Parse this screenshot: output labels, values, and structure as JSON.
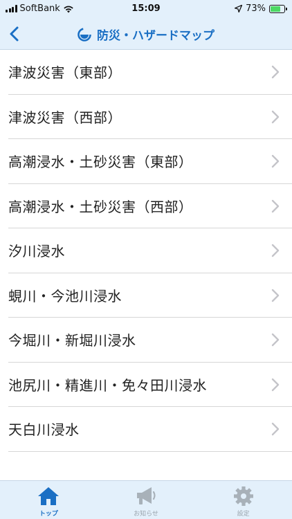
{
  "status": {
    "carrier": "SoftBank",
    "time": "15:09",
    "battery": "73%",
    "battery_level": 0.73
  },
  "nav": {
    "title": "防災・ハザードマップ"
  },
  "list": [
    {
      "label": "津波災害（東部）"
    },
    {
      "label": "津波災害（西部）"
    },
    {
      "label": "高潮浸水・土砂災害（東部）"
    },
    {
      "label": "高潮浸水・土砂災害（西部）"
    },
    {
      "label": "汐川浸水"
    },
    {
      "label": "蜆川・今池川浸水"
    },
    {
      "label": "今堀川・新堀川浸水"
    },
    {
      "label": "池尻川・精進川・免々田川浸水"
    },
    {
      "label": "天白川浸水"
    }
  ],
  "tabs": [
    {
      "label": "トップ",
      "icon": "home-icon",
      "active": true
    },
    {
      "label": "お知らせ",
      "icon": "megaphone-icon",
      "active": false
    },
    {
      "label": "設定",
      "icon": "gear-icon",
      "active": false
    }
  ],
  "colors": {
    "accent": "#1a6fc4",
    "bar_background": "#e3f0fb",
    "inactive_icon": "#a8b1b9"
  }
}
